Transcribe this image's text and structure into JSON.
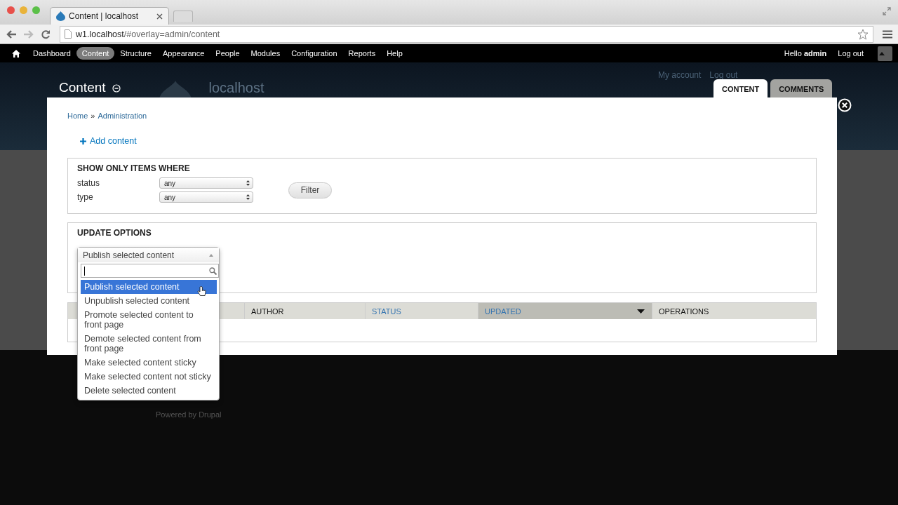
{
  "browser": {
    "tab": {
      "title": "Content | localhost"
    },
    "address": {
      "host": "w1.localhost",
      "path": "/#overlay=admin/content"
    }
  },
  "toolbar": {
    "items": [
      {
        "label": "Dashboard",
        "selected": false
      },
      {
        "label": "Content",
        "selected": true
      },
      {
        "label": "Structure",
        "selected": false
      },
      {
        "label": "Appearance",
        "selected": false
      },
      {
        "label": "People",
        "selected": false
      },
      {
        "label": "Modules",
        "selected": false
      },
      {
        "label": "Configuration",
        "selected": false
      },
      {
        "label": "Reports",
        "selected": false
      },
      {
        "label": "Help",
        "selected": false
      }
    ],
    "greeting": "Hello **admin**",
    "logout": "Log out"
  },
  "page": {
    "title": "Content",
    "site_name": "localhost",
    "secondary_links": [
      "My account",
      "Log out"
    ],
    "tabs": [
      {
        "label": "CONTENT",
        "selected": true
      },
      {
        "label": "COMMENTS",
        "selected": false
      }
    ],
    "footer": "Powered by Drupal"
  },
  "overlay": {
    "breadcrumb": {
      "items": [
        "Home",
        "Administration"
      ],
      "separator": "»"
    },
    "action_link": "Add content",
    "filter": {
      "legend": "SHOW ONLY ITEMS WHERE",
      "fields": [
        {
          "label": "status",
          "value": "any"
        },
        {
          "label": "type",
          "value": "any"
        }
      ],
      "button": "Filter"
    },
    "update": {
      "legend": "UPDATE OPTIONS",
      "select": {
        "value": "Publish selected content",
        "expanded": true,
        "options": [
          {
            "label": "Publish selected content",
            "selected": true
          },
          {
            "label": "Unpublish selected content",
            "selected": false
          },
          {
            "label": "Promote selected content to front page",
            "selected": false
          },
          {
            "label": "Demote selected content from front page",
            "selected": false
          },
          {
            "label": "Make selected content sticky",
            "selected": false
          },
          {
            "label": "Make selected content not sticky",
            "selected": false
          },
          {
            "label": "Delete selected content",
            "selected": false
          }
        ]
      }
    },
    "table": {
      "columns": [
        {
          "label": "AUTHOR",
          "sortable": false,
          "active": false
        },
        {
          "label": "STATUS",
          "sortable": true,
          "active": false
        },
        {
          "label": "UPDATED",
          "sortable": true,
          "active": true
        },
        {
          "label": "OPERATIONS",
          "sortable": false,
          "active": false
        }
      ]
    }
  }
}
